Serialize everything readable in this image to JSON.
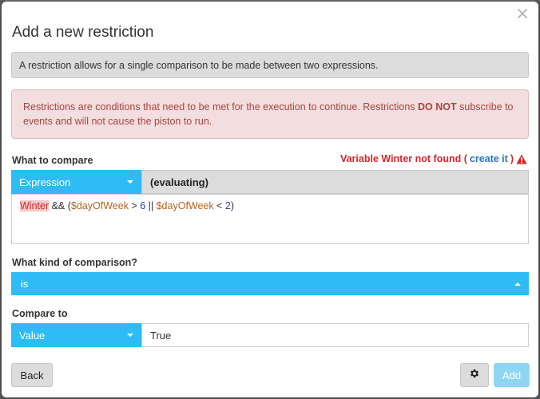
{
  "dialog": {
    "title": "Add a new restriction",
    "close_glyph": "×",
    "info": "A restriction allows for a single comparison to be made between two expressions.",
    "warning": {
      "part1": "Restrictions are conditions that need to be met for the execution to continue. Restrictions ",
      "bold": "DO NOT",
      "part2": " subscribe to events and will not cause the piston to run."
    }
  },
  "compare": {
    "label": "What to compare",
    "error": {
      "prefix": "Variable Winter not found (",
      "link": "create it",
      "suffix": ")"
    },
    "type_select": "Expression",
    "evaluating": "(evaluating)",
    "expression": [
      {
        "t": "Winter",
        "k": "err"
      },
      {
        "t": " && (",
        "k": "op"
      },
      {
        "t": "$dayOfWeek",
        "k": "var"
      },
      {
        "t": " > ",
        "k": "op"
      },
      {
        "t": "6",
        "k": "num"
      },
      {
        "t": " || ",
        "k": "op"
      },
      {
        "t": "$dayOfWeek",
        "k": "var"
      },
      {
        "t": " < ",
        "k": "op"
      },
      {
        "t": "2",
        "k": "num"
      },
      {
        "t": ")",
        "k": "op"
      }
    ]
  },
  "comparison": {
    "label": "What kind of comparison?",
    "selected": "is"
  },
  "compare_to": {
    "label": "Compare to",
    "type_select": "Value",
    "value": "True"
  },
  "footer": {
    "back": "Back",
    "add": "Add"
  },
  "colors": {
    "accent": "#2ebbf6",
    "error": "#d9262b",
    "warning_bg": "#f2dede",
    "warning_text": "#a94442"
  }
}
